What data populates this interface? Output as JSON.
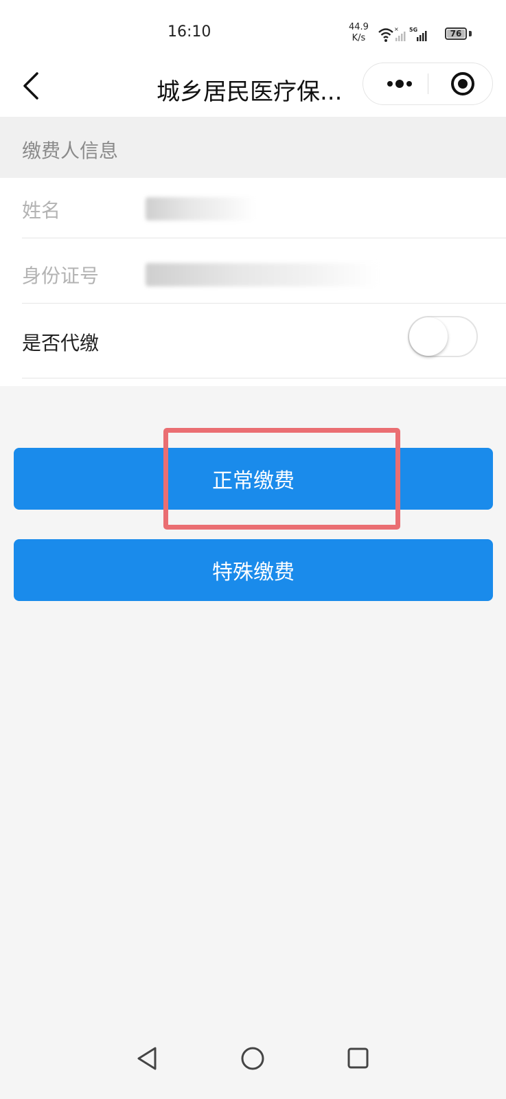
{
  "status_bar": {
    "time": "16:10",
    "net_speed_value": "44.9",
    "net_speed_unit": "K/s",
    "network_type": "5G",
    "battery": "76"
  },
  "navbar": {
    "title": "城乡居民医疗保..."
  },
  "payer_info": {
    "section_title": "缴费人信息",
    "name_label": "姓名",
    "id_label": "身份证号",
    "proxy_label": "是否代缴",
    "proxy_enabled": false
  },
  "actions": {
    "normal_payment": "正常缴费",
    "special_payment": "特殊缴费"
  },
  "highlight_color": "#ea6e72",
  "accent_color": "#1a8beb"
}
